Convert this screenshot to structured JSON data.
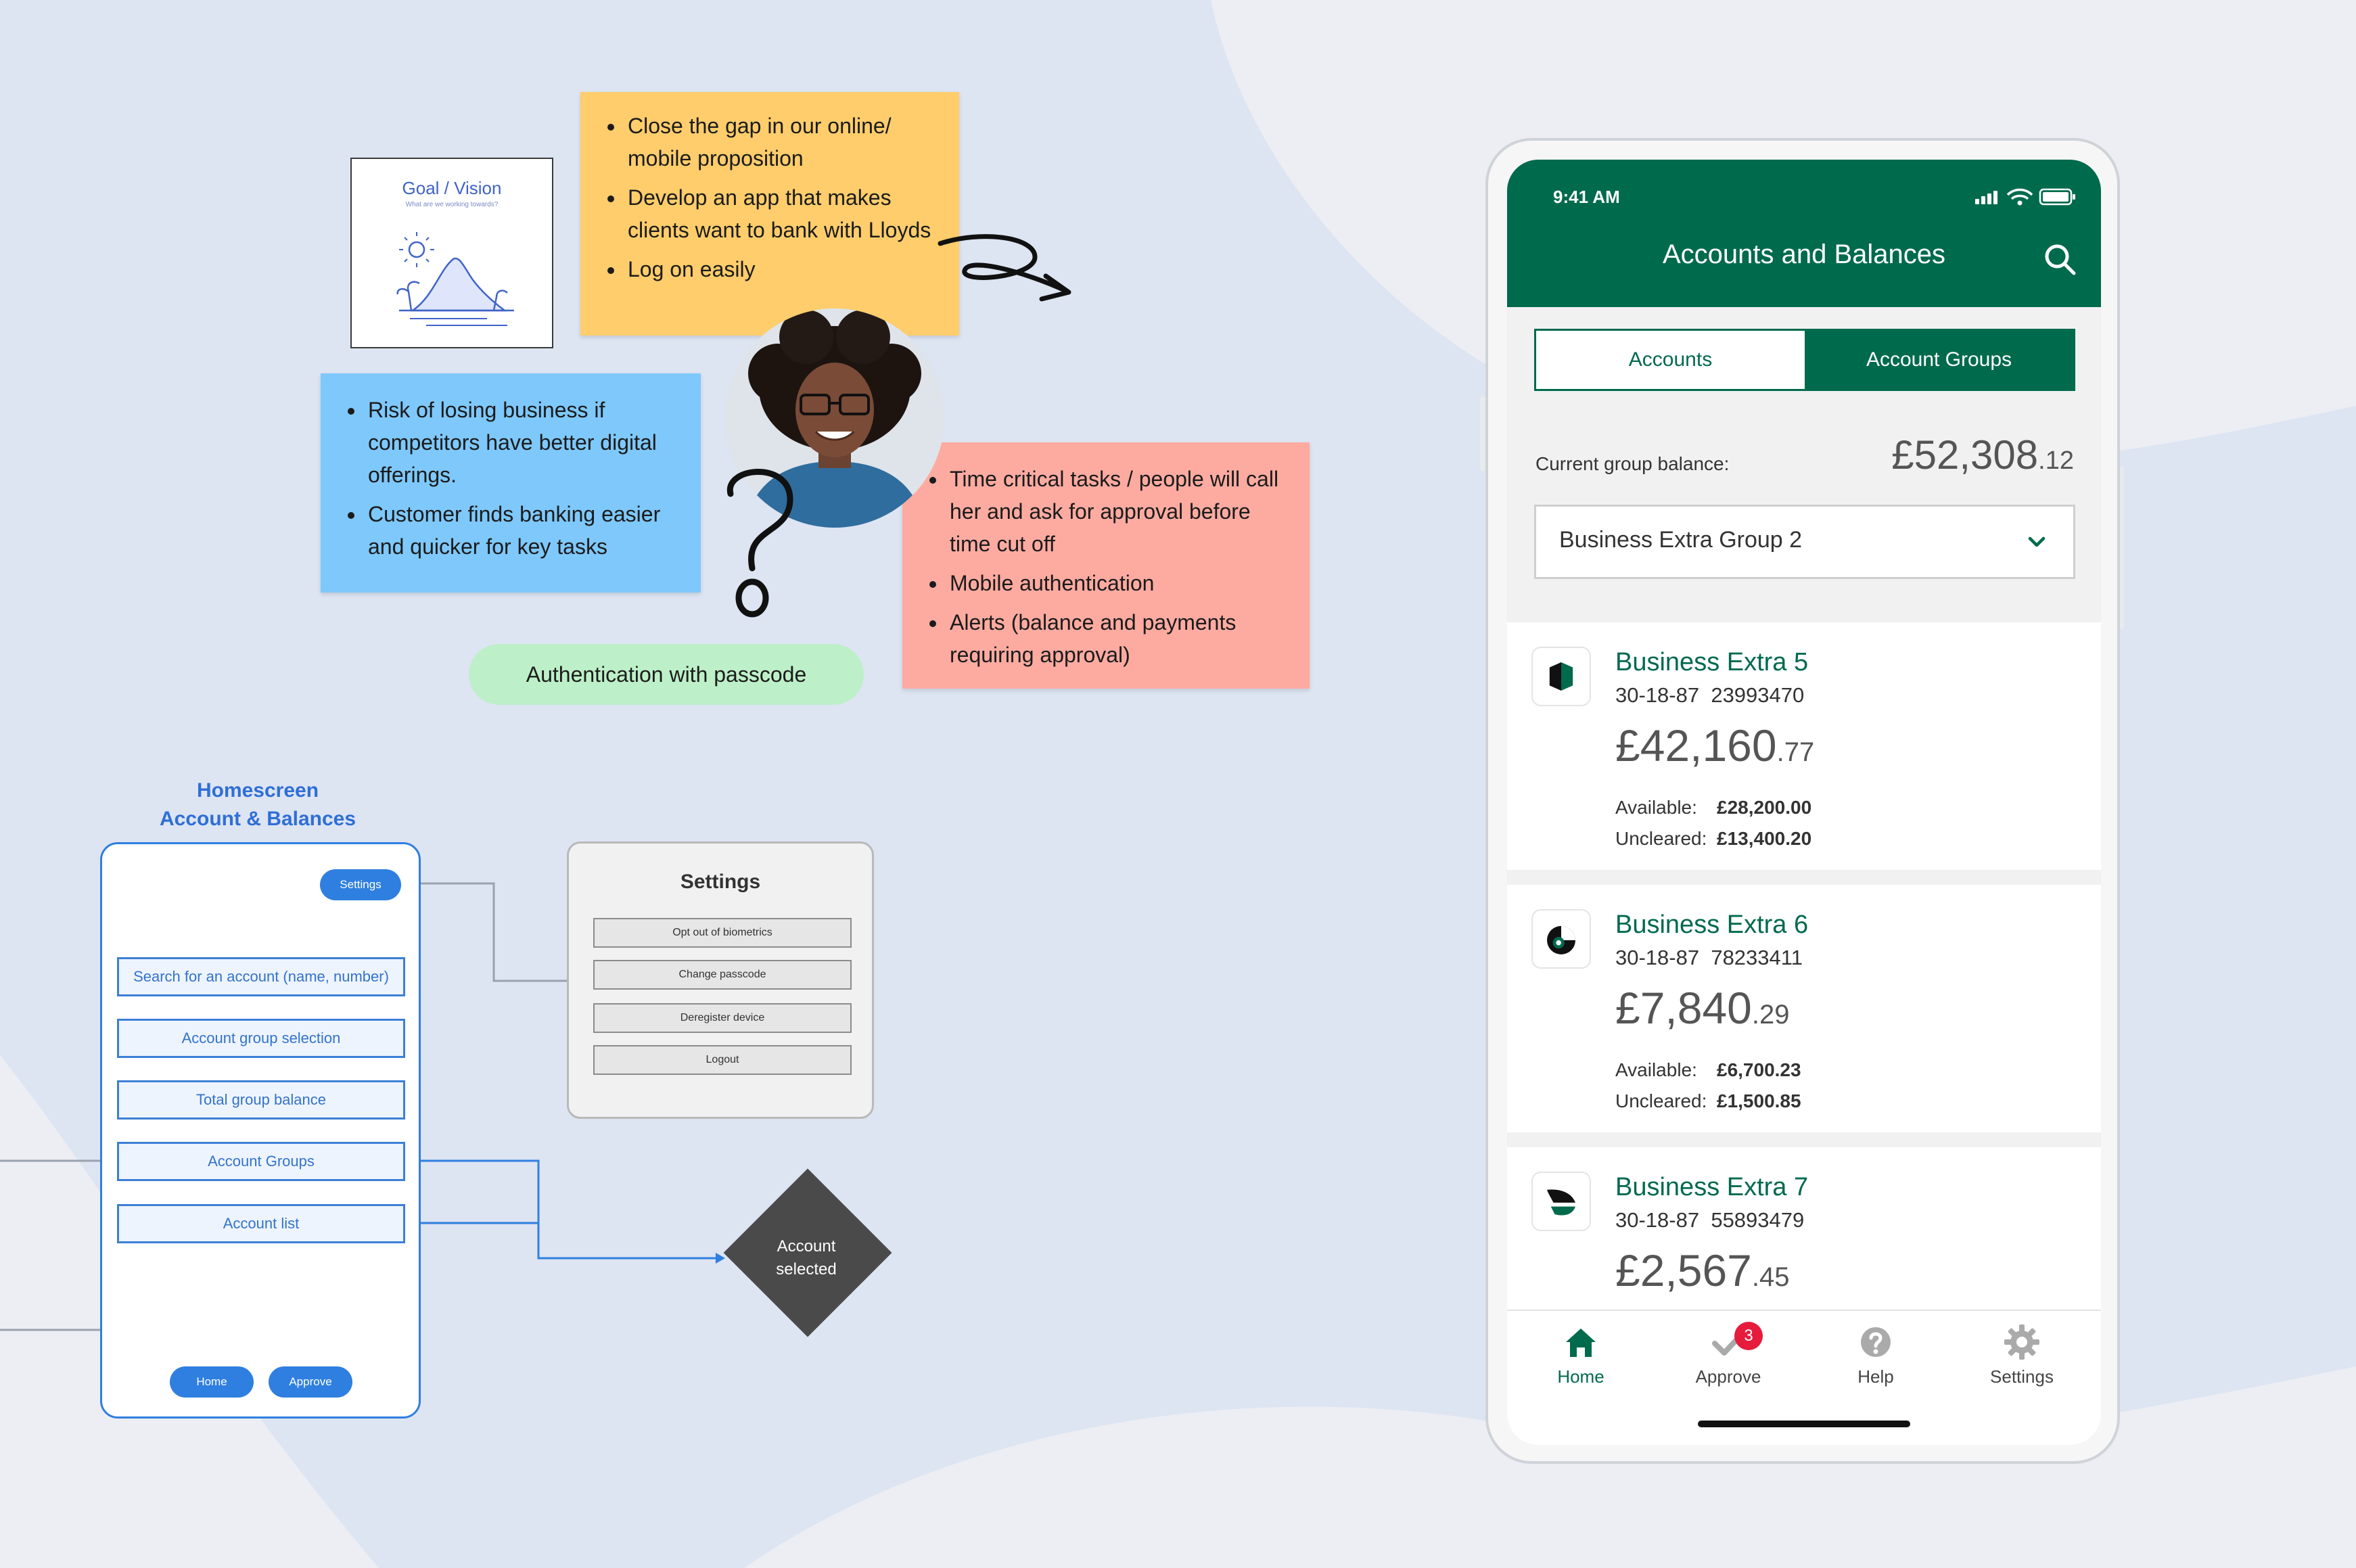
{
  "canvas": {
    "goal_card": {
      "title": "Goal / Vision",
      "subtitle": "What are we working towards?"
    },
    "note_yellow": {
      "items": [
        "Close the gap in our online/ mobile proposition",
        "Develop an app that makes clients want to bank with Lloyds",
        "Log on easily"
      ]
    },
    "note_blue": {
      "items": [
        "Risk of losing business if competitors have better digital offerings.",
        "Customer finds banking easier and quicker for key tasks"
      ]
    },
    "note_red": {
      "items": [
        "Time critical tasks / people will call her and ask for approval before time cut off",
        "Mobile authentication",
        "Alerts (balance and payments requiring approval)"
      ]
    },
    "auth_pill": "Authentication with passcode",
    "colors": {
      "yellow": "#ffcd6b",
      "blue": "#7ec8fb",
      "red": "#fdaba1",
      "green_pill": "#bdf0c8",
      "wireframe_blue": "#2f7fe0"
    }
  },
  "wireframe": {
    "title_line1": "Homescreen",
    "title_line2": "Account & Balances",
    "settings_button": "Settings",
    "boxes": [
      "Search for an account (name, number)",
      "Account group selection",
      "Total group balance",
      "Account Groups",
      "Account list"
    ],
    "home_button": "Home",
    "approve_button": "Approve",
    "settings_panel": {
      "title": "Settings",
      "items": [
        "Opt out of biometrics",
        "Change passcode",
        "Deregister device",
        "Logout"
      ]
    },
    "decision_line1": "Account",
    "decision_line2": "selected"
  },
  "phone": {
    "status_time": "9:41 AM",
    "title": "Accounts and Balances",
    "tabs": {
      "accounts": "Accounts",
      "groups": "Account Groups",
      "selected": "Account Groups"
    },
    "balance_label": "Current group balance:",
    "balance_main": "£52,308",
    "balance_cents": ".12",
    "group_select": "Business Extra Group 2",
    "accounts": [
      {
        "name": "Business Extra 5",
        "sort_code": "30-18-87",
        "number": "23993470",
        "balance_main": "£42,160",
        "balance_cents": ".77",
        "available_label": "Available:",
        "available": "£28,200.00",
        "uncleared_label": "Uncleared:",
        "uncleared": "£13,400.20"
      },
      {
        "name": "Business Extra 6",
        "sort_code": "30-18-87",
        "number": "78233411",
        "balance_main": "£7,840",
        "balance_cents": ".29",
        "available_label": "Available:",
        "available": "£6,700.23",
        "uncleared_label": "Uncleared:",
        "uncleared": "£1,500.85"
      },
      {
        "name": "Business Extra 7",
        "sort_code": "30-18-87",
        "number": "55893479",
        "balance_main": "£2,567",
        "balance_cents": ".45"
      }
    ],
    "tabbar": [
      {
        "label": "Home",
        "icon": "home-icon"
      },
      {
        "label": "Approve",
        "icon": "check-icon",
        "badge": "3"
      },
      {
        "label": "Help",
        "icon": "help-icon"
      },
      {
        "label": "Settings",
        "icon": "gear-icon"
      }
    ],
    "colors": {
      "brand_green": "#006a4d",
      "badge_red": "#e51c3c"
    }
  }
}
